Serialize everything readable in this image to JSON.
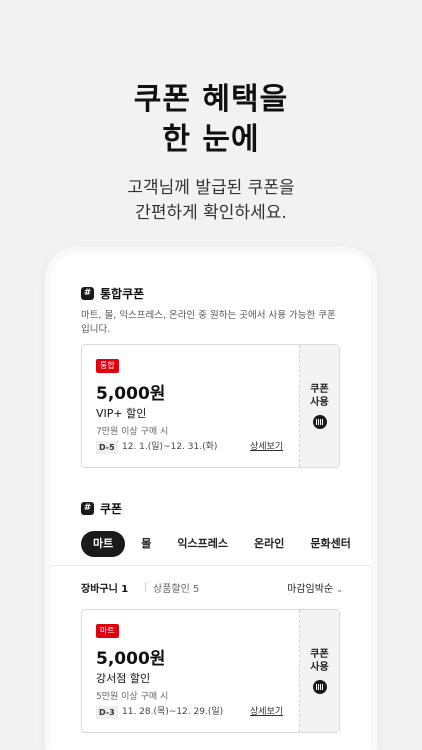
{
  "headline": {
    "line1": "쿠폰 혜택을",
    "line2": "한 눈에"
  },
  "subline": {
    "line1": "고객님께 발급된 쿠폰을",
    "line2": "간편하게 확인하세요."
  },
  "integrated": {
    "title": "통합쿠폰",
    "description": "마트, 몰, 익스프레스, 온라인 중 원하는 곳에서 사용 가능한 쿠폰입니다.",
    "coupon": {
      "tag": "통합",
      "amount": "5,000원",
      "name": "VIP+ 할인",
      "condition": "7만원 이상 구매 시",
      "dday": "D-5",
      "period": "12. 1.(일)~12. 31.(화)",
      "detail": "상세보기",
      "use_label": "쿠폰 사용",
      "tag_color": "#e1000f"
    }
  },
  "coupons": {
    "title": "쿠폰",
    "tabs": [
      "마트",
      "몰",
      "익스프레스",
      "온라인",
      "문화센터"
    ],
    "active_tab": "마트",
    "cart_label": "장바구니 1",
    "goods_label": "상품할인 5",
    "sort_label": "마감임박순",
    "sort_icon": "chevron-down-icon",
    "coupon": {
      "tag": "마트",
      "amount": "5,000원",
      "name": "강서점 할인",
      "condition": "5만원 이상 구매 시",
      "dday": "D-3",
      "period": "11. 28.(목)~12. 29.(일)",
      "detail": "상세보기",
      "use_label": "쿠폰 사용",
      "tag_color": "#e1000f"
    }
  }
}
